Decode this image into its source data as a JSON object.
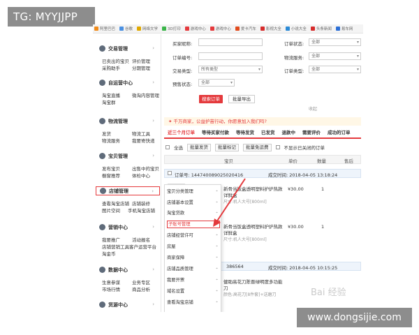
{
  "overlay_tag": "TG: MYYJJPP",
  "footer_url": "www.dongsijie.com",
  "watermark": "Bai 经验",
  "bookmarks": [
    "阿里巴巴",
    "谷歌",
    "网络文学",
    "3D打印",
    "游戏中心",
    "游戏中心",
    "爱卡汽车",
    "影视大全",
    "小说大全",
    "头条新闻",
    "易车网"
  ],
  "sidebar": [
    {
      "title": "交易管理",
      "links": [
        "已卖出的宝贝",
        "评价管理",
        "采购助手",
        "分期管理"
      ]
    },
    {
      "title": "自运营中心",
      "links": [
        "淘宝直播",
        "微淘内容管理",
        "淘宝群"
      ]
    },
    {
      "title": "物流管理",
      "links": [
        "发货",
        "物流工具",
        "物流服务",
        "我要寄快递"
      ]
    },
    {
      "title": "宝贝管理",
      "links": [
        "发布宝贝",
        "出售中的宝贝",
        "橱窗推荐",
        "体检中心"
      ]
    },
    {
      "title": "店铺管理",
      "links": [
        "查看淘宝店铺",
        "店铺装修",
        "图片空间",
        "手机淘宝店铺"
      ]
    },
    {
      "title": "营销中心",
      "links": [
        "我要推广",
        "活动报名",
        "店铺营销工具",
        "客户运营平台",
        "淘金币"
      ]
    },
    {
      "title": "数据中心",
      "links": [
        "生意参谋",
        "业务专区",
        "市场行情",
        "商品分析"
      ]
    },
    {
      "title": "货源中心",
      "links": []
    }
  ],
  "search_form": {
    "fields": [
      {
        "label": "买家昵称:",
        "value": ""
      },
      {
        "label": "订单编号:",
        "value": ""
      },
      {
        "label": "交易类型:",
        "value": "所有类型"
      },
      {
        "label": "预售状态:",
        "value": "全部"
      },
      {
        "label": "订单状态:",
        "value": "全部"
      },
      {
        "label": "物流服务:",
        "value": "全部"
      },
      {
        "label": "订单类型:",
        "value": "全部"
      }
    ],
    "search_button": "搜索订单",
    "export_button": "批量导出",
    "collapse_label": "收起"
  },
  "notice": "✦ 千万商家，公益护苗行动，你愿意加入我们吗?",
  "tabs": [
    "近三个月订单",
    "等待买家付款",
    "等待发货",
    "已发货",
    "退款中",
    "需要评价",
    "成功的订单"
  ],
  "filters": {
    "select_all": "全选",
    "batch_ship": "批量发货",
    "batch_mark": "批量标记",
    "batch_free": "批量免运费",
    "hide_closed": "不显示已关闭的订单"
  },
  "table_headers": [
    "宝贝",
    "单价",
    "数量",
    "售后"
  ],
  "orders": [
    {
      "order_no_label": "订单号: 1447400890250204​16",
      "time": "成交时间: 2018-04-05 13:18:24",
      "title": "新骨当饭盒透明塑料护炉热款",
      "title2": "详鲜盒",
      "attr": "尺寸:机人大号[800ml]",
      "price": "¥30.00",
      "qty": "1"
    },
    {
      "order_no_label": "",
      "time": "",
      "title": "新骨当饭盒透明塑料护炉热款",
      "title2": "详鲜盒",
      "attr": "尺寸:机人大号[800ml]",
      "price": "¥30.00",
      "qty": "1"
    },
    {
      "order_no_label": "386564",
      "time": "成交时间: 2018-04-05 10:15:25",
      "title": "健助高花刀陈晋绿明度多功能",
      "title2": "刀",
      "attr": "颜色:高花刀[8件套]+送磨刀",
      "price": "",
      "qty": ""
    }
  ],
  "flyout": {
    "items": [
      "宝贝分类管理",
      "店铺基本设置",
      "淘宝贷款",
      "子账号管理",
      "店铺经营许可",
      "房屋",
      "商家保障",
      "店铺品质管理",
      "我要开票",
      "域名设置",
      "查看淘宝店铺"
    ],
    "highlighted_index": 3
  },
  "colors": {
    "accent": "#e4393c",
    "tab_underline": "#e4393c",
    "overlay": "#8d8d8d"
  }
}
